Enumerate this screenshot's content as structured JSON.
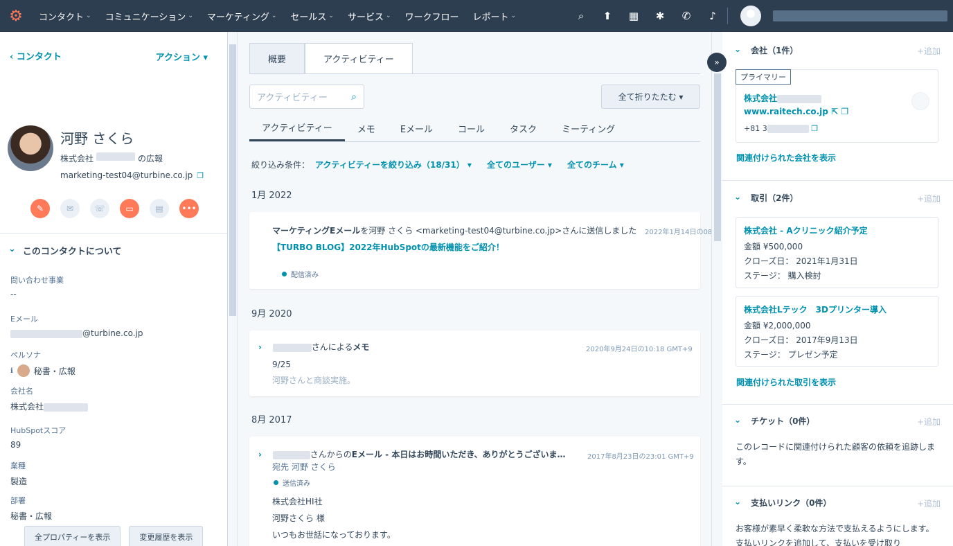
{
  "nav": {
    "items": [
      "コンタクト",
      "コミュニケーション",
      "マーケティング",
      "セールス",
      "サービス",
      "ワークフロー",
      "レポート"
    ],
    "has_caret": [
      true,
      true,
      true,
      true,
      true,
      false,
      true
    ],
    "icons": [
      "search-icon",
      "upgrade-icon",
      "marketplace-icon",
      "settings-icon",
      "calling-icon",
      "notifications-icon"
    ]
  },
  "left": {
    "back": "‹ コンタクト",
    "actions": "アクション ▾",
    "name": "河野 さくら",
    "company_prefix": "株式会社",
    "company_suffix": "の広報",
    "email": "marketing-test04@turbine.co.jp",
    "about_title": "このコンタクトについて",
    "props": {
      "inquiry_label": "問い合わせ事業",
      "inquiry_value": "--",
      "email_label": "Eメール",
      "email_value": "@turbine.co.jp",
      "persona_label": "ペルソナ",
      "persona_value": "秘書・広報",
      "company_label": "会社名",
      "company_value": "株式会社",
      "score_label": "HubSpotスコア",
      "score_value": "89",
      "industry_label": "業種",
      "industry_value": "製造",
      "dept_label": "部署",
      "dept_value": "秘書・広報"
    },
    "btn_all_props": "全プロパティーを表示",
    "btn_history": "変更履歴を表示"
  },
  "middle": {
    "tab_overview": "概要",
    "tab_activity": "アクティビティー",
    "search_placeholder": "アクティビティー",
    "collapse_all": "全て折りたたむ ▾",
    "subtabs": [
      "アクティビティー",
      "メモ",
      "Eメール",
      "コール",
      "タスク",
      "ミーティング"
    ],
    "filter_label": "絞り込み条件：",
    "filter_activity": "アクティビティーを絞り込み（18/31） ▾",
    "filter_users": "全てのユーザー ▾",
    "filter_teams": "全てのチーム ▾",
    "months": [
      "1月 2022",
      "9月 2020",
      "8月 2017"
    ],
    "card1": {
      "title_bold": "マーケティングEメール",
      "title_rest": "を河野 さくら <marketing-test04@turbine.co.jp>さんに送信しました",
      "ts": "2022年1月14日の08",
      "link": "【TURBO BLOG】2022年HubSpotの最新機能をご紹介！",
      "status": "配信済み"
    },
    "card2": {
      "title_rest": "さんによる",
      "title_bold": "メモ",
      "ts": "2020年9月24日の10:18 GMT+9",
      "line1": "9/25",
      "line2": "河野さんと商談実施。"
    },
    "card3": {
      "title_rest": "さんからの",
      "title_bold": "Eメール - 本日はお時間いただき、ありがとうございま…",
      "ts": "2017年8月23日の23:01 GMT+9",
      "to": "宛先 河野 さくら",
      "status": "送信済み",
      "body1": "株式会社HI社",
      "body2": "河野さくら 様",
      "body3": "いつもお世話になっております。"
    }
  },
  "right": {
    "company_title": "会社（1件）",
    "add": "+追加",
    "primary": "プライマリー",
    "company_name": "株式会社",
    "company_domain": "www.raitech.co.jp",
    "company_phone": "+81 3",
    "company_view": "関連付けられた会社を表示",
    "deals_title": "取引（2件）",
    "deal1": {
      "name": "株式会社 - Aクリニック紹介予定",
      "amount": "金額 ¥500,000",
      "close": "クローズ日： 2021年1月31日",
      "stage": "ステージ： 購入検討"
    },
    "deal2": {
      "name": "株式会社Lテック　3Dプリンター導入",
      "amount": "金額 ¥2,000,000",
      "close": "クローズ日： 2017年9月13日",
      "stage": "ステージ： プレゼン予定"
    },
    "deals_view": "関連付けられた取引を表示",
    "tickets_title": "チケット（0件）",
    "tickets_text": "このレコードに関連付けられた顧客の依頼を追跡します。",
    "payments_title": "支払いリンク（0件）",
    "payments_text": "お客様が素早く柔軟な方法で支払えるようにします。支払いリンクを追加して、支払いを受け取り"
  }
}
